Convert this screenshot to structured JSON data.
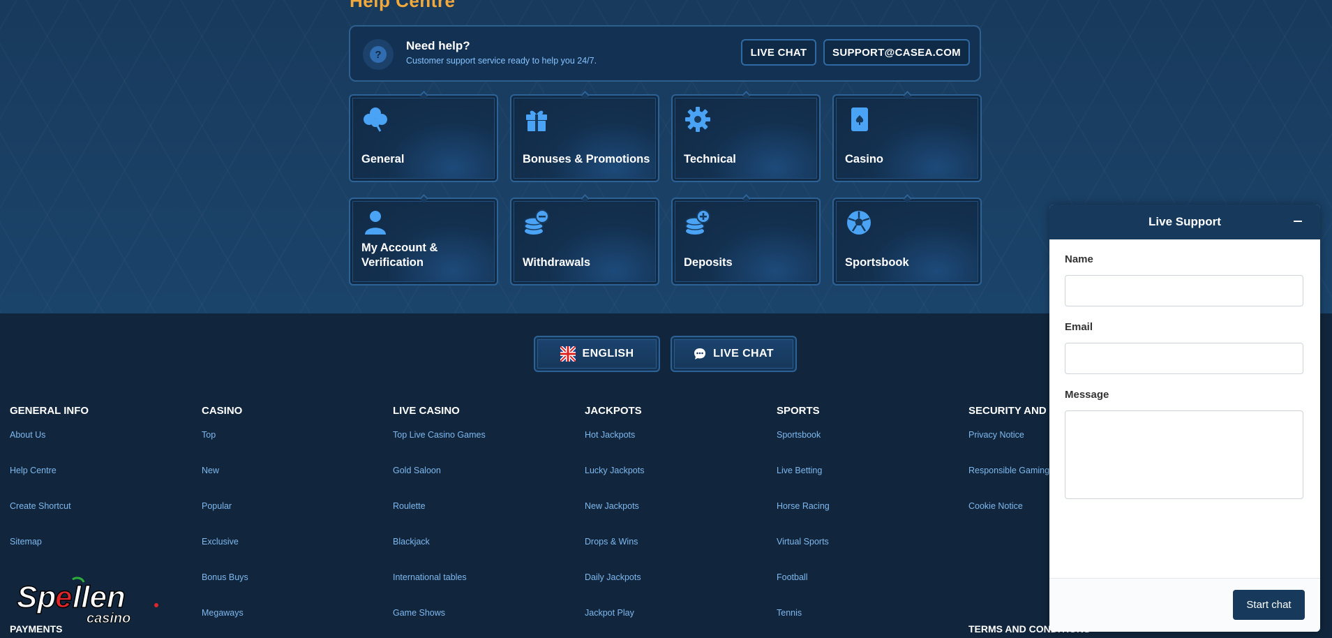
{
  "help": {
    "title": "Help Centre",
    "need_help_title": "Need help?",
    "need_help_sub": "Customer support service ready to help you 24/7.",
    "live_chat_label": "LIVE CHAT",
    "email_label": "SUPPORT@CASEA.COM",
    "question_mark": "?"
  },
  "categories": [
    {
      "label": "General",
      "icon": "clover-icon"
    },
    {
      "label": "Bonuses & Promotions",
      "icon": "gift-icon"
    },
    {
      "label": "Technical",
      "icon": "gear-icon"
    },
    {
      "label": "Casino",
      "icon": "playing-card-icon"
    },
    {
      "label": "My Account & Verification",
      "icon": "user-icon"
    },
    {
      "label": "Withdrawals",
      "icon": "coins-minus-icon"
    },
    {
      "label": "Deposits",
      "icon": "coins-plus-icon"
    },
    {
      "label": "Sportsbook",
      "icon": "soccer-ball-icon"
    }
  ],
  "footer": {
    "language_label": "ENGLISH",
    "live_chat_label": "LIVE CHAT",
    "columns": [
      {
        "heading": "GENERAL INFO",
        "links": [
          "About Us",
          "Help Centre",
          "Create Shortcut",
          "Sitemap"
        ]
      },
      {
        "heading": "CASINO",
        "links": [
          "Top",
          "New",
          "Popular",
          "Exclusive",
          "Bonus Buys",
          "Megaways"
        ]
      },
      {
        "heading": "LIVE CASINO",
        "links": [
          "Top Live Casino Games",
          "Gold Saloon",
          "Roulette",
          "Blackjack",
          "International tables",
          "Game Shows"
        ]
      },
      {
        "heading": "JACKPOTS",
        "links": [
          "Hot Jackpots",
          "Lucky Jackpots",
          "New Jackpots",
          "Drops & Wins",
          "Daily Jackpots",
          "Jackpot Play"
        ]
      },
      {
        "heading": "SPORTS",
        "links": [
          "Sportsbook",
          "Live Betting",
          "Horse Racing",
          "Virtual Sports",
          "Football",
          "Tennis"
        ]
      },
      {
        "heading": "SECURITY AND P",
        "links": [
          "Privacy Notice",
          "Responsible Gaming",
          "Cookie Notice"
        ]
      }
    ],
    "payments_heading": "PAYMENTS",
    "terms_heading": "TERMS AND CONDITIONS",
    "logo": {
      "word": "Spellen",
      "sub": "casino"
    }
  },
  "widget": {
    "title": "Live Support",
    "name_label": "Name",
    "email_label": "Email",
    "message_label": "Message",
    "start_label": "Start chat"
  },
  "colors": {
    "accent_orange": "#f2a93b",
    "navy": "#173a5c",
    "link_blue": "#7fb8ef"
  }
}
